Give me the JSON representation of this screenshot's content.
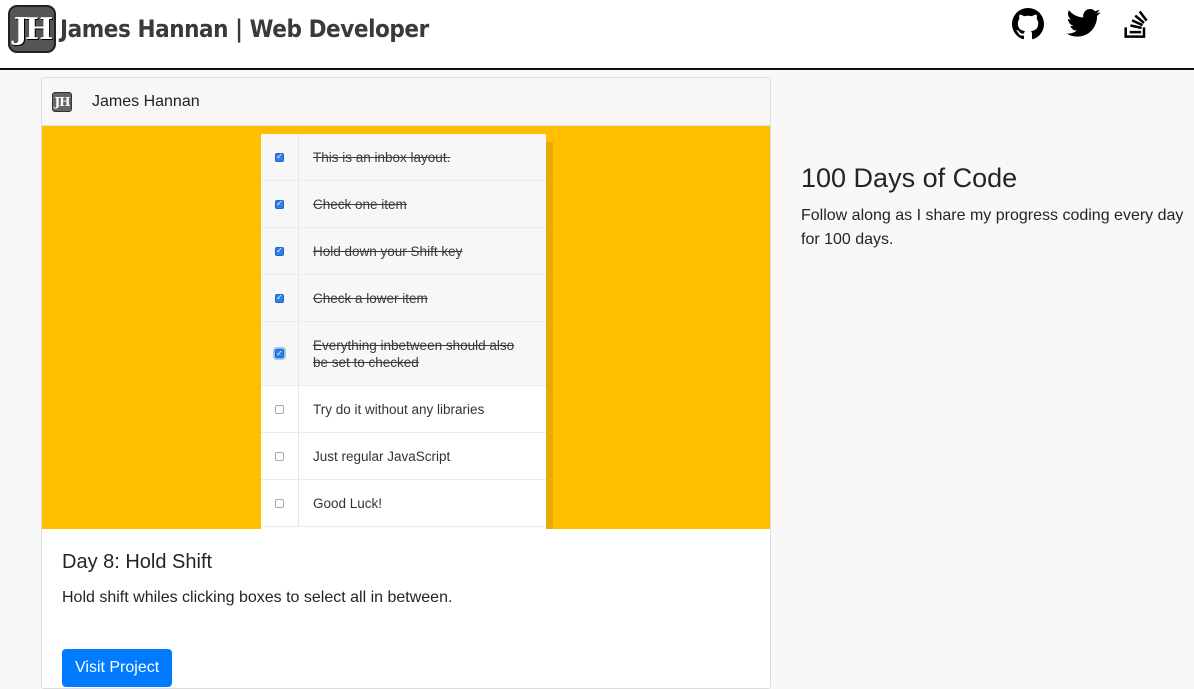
{
  "navbar": {
    "logo_letters": "JH",
    "brand_title": "James Hannan | Web Developer",
    "social": [
      {
        "icon": "github-icon",
        "label": "GitHub"
      },
      {
        "icon": "twitter-icon",
        "label": "Twitter"
      },
      {
        "icon": "stackoverflow-icon",
        "label": "Stack Overflow"
      }
    ]
  },
  "card": {
    "header": {
      "logo_letters": "JH",
      "author": "James Hannan"
    },
    "preview": {
      "background_color": "#ffbe00",
      "items": [
        {
          "text": "This is an inbox layout.",
          "checked": true
        },
        {
          "text": "Check one item",
          "checked": true
        },
        {
          "text": "Hold down your Shift key",
          "checked": true
        },
        {
          "text": "Check a lower item",
          "checked": true
        },
        {
          "text": "Everything inbetween should also be set to checked",
          "checked": true
        },
        {
          "text": "Try do it without any libraries",
          "checked": false
        },
        {
          "text": "Just regular JavaScript",
          "checked": false
        },
        {
          "text": "Good Luck!",
          "checked": false
        }
      ]
    },
    "title": "Day 8: Hold Shift",
    "text": "Hold shift whiles clicking boxes to select all in between.",
    "button_label": "Visit Project",
    "button_color": "#007bff"
  },
  "side": {
    "title": "100 Days of Code",
    "text": "Follow along as I share my progress coding every day for 100 days."
  }
}
